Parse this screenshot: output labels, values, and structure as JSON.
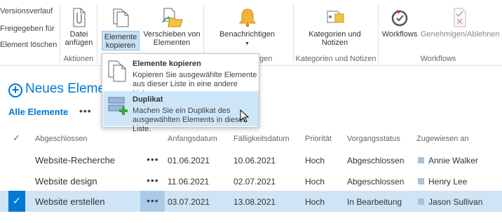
{
  "ribbon": {
    "left_commands": [
      "Versionsverlauf",
      "Freigegeben für",
      "Element löschen"
    ],
    "datei_anfuegen": [
      "Datei",
      "anfügen"
    ],
    "elemente_kopieren": [
      "Elemente",
      "kopieren"
    ],
    "verschieben": [
      "Verschieben von",
      "Elementen"
    ],
    "benachrichtigen": "Benachrichtigen",
    "kategorien": [
      "Kategorien und",
      "Notizen"
    ],
    "workflows": "Workflows",
    "genehmigen": "Genehmigen/Ablehnen",
    "groups": {
      "aktionen": "Aktionen",
      "en_partial": "gen",
      "kategorien": "Kategorien und Notizen",
      "workflows": "Workflows"
    }
  },
  "menu": {
    "items": [
      {
        "title": "Elemente kopieren",
        "desc": "Kopieren Sie ausgewählte Elemente aus dieser Liste in eine andere Liste."
      },
      {
        "title": "Duplikat",
        "desc": "Machen Sie ein Duplikat des ausgewählten Elements in dieser Liste."
      }
    ]
  },
  "list": {
    "new_item": "Neues Eleme",
    "view_name": "Alle Elemente",
    "more": "•••",
    "check_icon": "✓",
    "columns": [
      "Abgeschlossen",
      "Anfangsdatum",
      "Fälligkeitsdatum",
      "Priorität",
      "Vorgangsstatus",
      "Zugewiesen an"
    ],
    "rows": [
      {
        "title": "Website-Recherche",
        "start": "01.06.2021",
        "due": "10.06.2021",
        "priority": "Hoch",
        "status": "Abgeschlossen",
        "assigned": "Annie Walker",
        "selected": false
      },
      {
        "title": "Website design",
        "start": "11.06.2021",
        "due": "02.07.2021",
        "priority": "Hoch",
        "status": "Abgeschlossen",
        "assigned": "Henry Lee",
        "selected": false
      },
      {
        "title": "Website erstellen",
        "start": "03.07.2021",
        "due": "13.08.2021",
        "priority": "Hoch",
        "status": "In Bearbeitung",
        "assigned": "Jason Sullivan",
        "selected": true
      }
    ]
  }
}
